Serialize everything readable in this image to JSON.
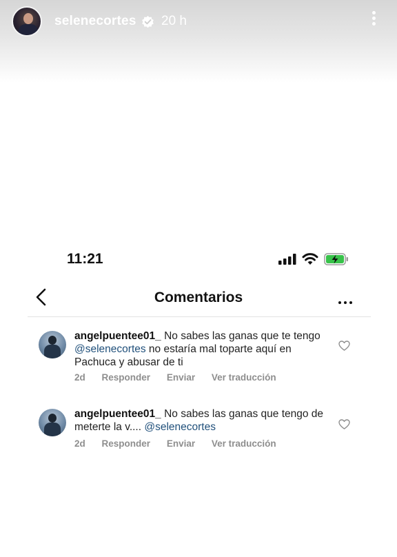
{
  "story": {
    "username": "selenecortes",
    "time": "20 h"
  },
  "status_bar": {
    "time": "11:21"
  },
  "header": {
    "title": "Comentarios"
  },
  "comments": [
    {
      "username": "angelpuentee01_",
      "text_before": "No sabes las ganas que te tengo ",
      "mention": "@selenecortes",
      "text_after": " no estaría mal toparte aquí en Pachuca y abusar de ti",
      "time": "2d",
      "reply": "Responder",
      "send": "Enviar",
      "translate": "Ver traducción"
    },
    {
      "username": "angelpuentee01_",
      "text_before": "No sabes las ganas que tengo de meterte la v.... ",
      "mention": "@selenecortes",
      "text_after": "",
      "time": "2d",
      "reply": "Responder",
      "send": "Enviar",
      "translate": "Ver traducción"
    }
  ]
}
